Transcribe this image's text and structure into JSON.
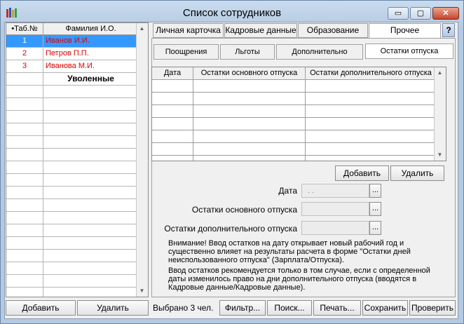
{
  "window": {
    "title": "Список сотрудников",
    "minimize": "▭",
    "maximize": "▢",
    "close": "✕"
  },
  "employees": {
    "headers": [
      "•Таб.№",
      "Фамилия И.О."
    ],
    "rows": [
      {
        "num": "1",
        "name": "Иванов И.И."
      },
      {
        "num": "2",
        "name": "Петров П.П."
      },
      {
        "num": "3",
        "name": "Иванова М.И."
      }
    ],
    "section_label": "Уволенные"
  },
  "tabs": [
    "Личная карточка",
    "Кадровые данные",
    "Образование",
    "Прочее"
  ],
  "help_label": "?",
  "subtabs": [
    "Поощрения",
    "Льготы",
    "Дополнительно",
    "Остатки отпуска"
  ],
  "leave_grid": {
    "headers": [
      "Дата",
      "Остатки основного отпуска",
      "Остатки дополнительного отпуска"
    ]
  },
  "grid_buttons": {
    "add": "Добавить",
    "delete": "Удалить"
  },
  "form": {
    "date_label": "Дата",
    "date_value": "  .  .",
    "main_leave_label": "Остатки основного отпуска",
    "extra_leave_label": "Остатки дополнительного отпуска",
    "dots": "..."
  },
  "note": {
    "p1": "Внимание! Ввод остатков на дату открывает новый рабочий год и существенно влияет на результаты расчета в форме \"Остатки дней неиспользованного отпуска\" (Зарплата/Отпуска).",
    "p2": "Ввод остатков рекомендуется только в том случае, если с определенной даты изменилось право на дни дополнительного отпуска (вводятся в Кадровые данные/Кадровые данные)."
  },
  "footer": {
    "add": "Добавить",
    "delete": "Удалить",
    "selected": "Выбрано 3 чел.",
    "filter": "Фильтр...",
    "search": "Поиск...",
    "print": "Печать...",
    "save": "Сохранить",
    "check": "Проверить"
  },
  "colors": {
    "selection": "#3399ff",
    "red_text": "#e00000"
  }
}
